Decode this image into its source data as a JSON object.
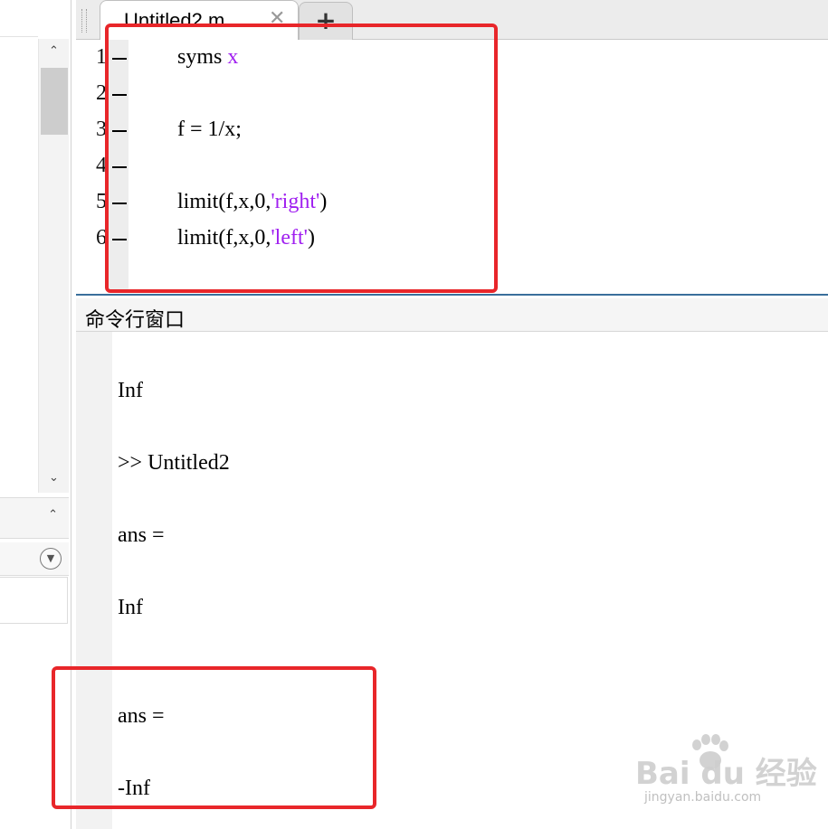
{
  "editor": {
    "tab_title": "Untitled2.m",
    "tab_close": "✕",
    "tab_add": "+",
    "lines": [
      {
        "num": "1",
        "segments": [
          {
            "text": "syms "
          },
          {
            "text": "x",
            "kw": true
          }
        ]
      },
      {
        "num": "2",
        "segments": []
      },
      {
        "num": "3",
        "segments": [
          {
            "text": "f = 1/x;"
          }
        ]
      },
      {
        "num": "4",
        "segments": []
      },
      {
        "num": "5",
        "segments": [
          {
            "text": "limit(f,x,0,"
          },
          {
            "text": "'right'",
            "kw": true
          },
          {
            "text": ")"
          }
        ]
      },
      {
        "num": "6",
        "segments": [
          {
            "text": "limit(f,x,0,"
          },
          {
            "text": "'left'",
            "kw": true
          },
          {
            "text": ")"
          }
        ]
      }
    ]
  },
  "command_window": {
    "title": "命令行窗口",
    "output_lines": [
      "Inf",
      ">> Untitled2",
      "ans =",
      "Inf",
      "ans =",
      "-Inf"
    ]
  },
  "left_panel": {
    "scroll_up": "⌃",
    "scroll_down": "⌄",
    "collapse": "⌃",
    "menu": "▼"
  },
  "watermark": {
    "main": "Bai du 经验",
    "sub": "jingyan.baidu.com"
  },
  "colors": {
    "keyword": "#a020f0",
    "highlight_box": "#e8262a",
    "editor_border": "#3a6f9b"
  }
}
